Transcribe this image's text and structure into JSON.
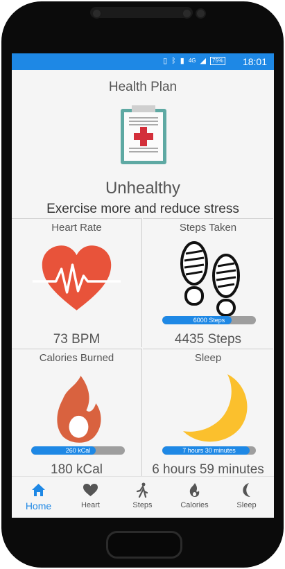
{
  "status_bar": {
    "signal": "4G",
    "battery": "75%",
    "time": "18:01"
  },
  "header": {
    "title": "Health Plan",
    "status": "Unhealthy",
    "advice": "Exercise more and reduce stress"
  },
  "cards": {
    "heart": {
      "label": "Heart Rate",
      "value": "73 BPM"
    },
    "steps": {
      "label": "Steps Taken",
      "value": "4435 Steps",
      "goal_label": "6000 Steps",
      "progress": 0.74
    },
    "calories": {
      "label": "Calories Burned",
      "value": "180 kCal",
      "goal_label": "260 kCal",
      "progress": 0.69
    },
    "sleep": {
      "label": "Sleep",
      "value": "6 hours 59 minutes",
      "goal_label": "7 hours 30 minutes",
      "progress": 0.93
    }
  },
  "nav": {
    "items": [
      {
        "label": "Home",
        "icon": "home-icon",
        "active": true
      },
      {
        "label": "Heart",
        "icon": "heart-icon",
        "active": false
      },
      {
        "label": "Steps",
        "icon": "walking-icon",
        "active": false
      },
      {
        "label": "Calories",
        "icon": "flame-icon",
        "active": false
      },
      {
        "label": "Sleep",
        "icon": "moon-icon",
        "active": false
      }
    ]
  },
  "colors": {
    "accent": "#1e88e5",
    "heart": "#e8533a",
    "flame": "#d9623f",
    "moon": "#fbc02d"
  }
}
